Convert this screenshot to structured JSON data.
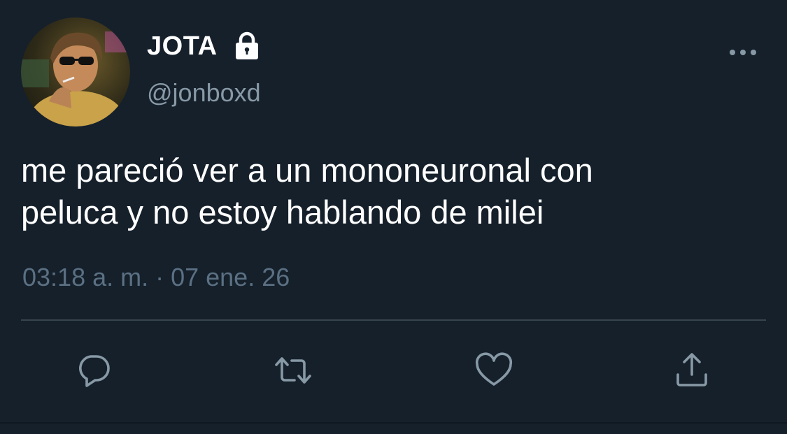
{
  "tweet": {
    "display_name": "JOTA",
    "handle": "@jonboxd",
    "text": "me pareció ver a un mononeuronal con\npeluca y no estoy hablando de milei",
    "timestamp": "03:18 a. m. · 07 ene. 26"
  },
  "icons": {
    "protected": "lock-icon",
    "more": "more-horizontal-icon",
    "reply": "speech-bubble-icon",
    "retweet": "retweet-icon",
    "like": "heart-icon",
    "share": "share-upload-icon"
  },
  "colors": {
    "background": "#15202b",
    "primary_text": "#ffffff",
    "secondary_text": "#8899a6",
    "timestamp_text": "#5b7083",
    "divider": "#38444d",
    "icon": "#8899a6"
  }
}
